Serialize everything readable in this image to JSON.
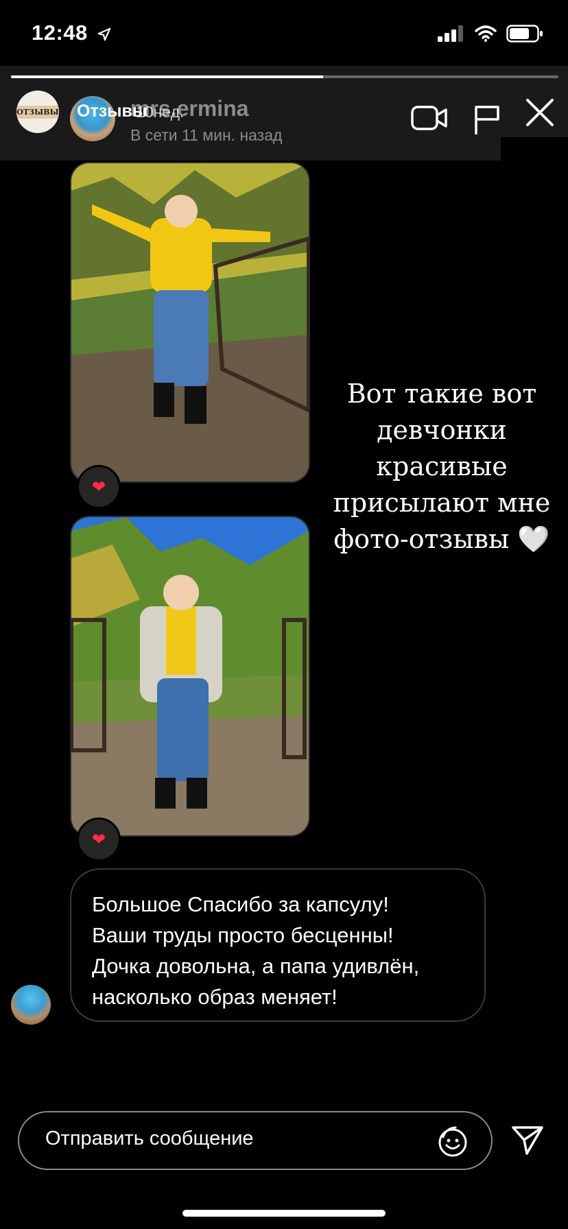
{
  "status_bar": {
    "time": "12:48",
    "location_icon": "location-arrow-icon",
    "signal_icon": "cellular-signal-icon",
    "wifi_icon": "wifi-icon",
    "battery_icon": "battery-icon"
  },
  "story": {
    "progress_fraction": 0.57,
    "account_label": "Отзывы",
    "avatar_text": "ОТЗЫВЫ",
    "age": "10нед.",
    "video_icon": "video-camera-icon",
    "report_icon": "flag-icon",
    "close_icon": "close-icon"
  },
  "chat": {
    "username": "mrs.ermina",
    "online_status": "В сети 11 мин. назад"
  },
  "photos": [
    {
      "reaction": "❤",
      "sky": "#2f74c9",
      "foliage": "#b9b23a",
      "ground": "#6a5a48",
      "sweater": "#f2c714",
      "jeans": "#4a7bb7"
    },
    {
      "reaction": "❤",
      "sky": "#2d74d6",
      "foliage": "#5f8d2e",
      "ground": "#8a7a63",
      "sweater": "#f0c81a",
      "jeans": "#3e6fae"
    }
  ],
  "caption": "Вот такие вот\nдевчонки\nкрасивые\nприсылают мне\nфото-отзывы 🤍",
  "message": {
    "text": "Большое Спасибо за капсулу!\nВаши труды просто бесценны!\nДочка довольна, а папа удивлён,\nнасколько образ меняет!"
  },
  "composer": {
    "placeholder": "Отправить сообщение",
    "emoji_icon": "emoji-icon",
    "send_icon": "send-icon"
  }
}
